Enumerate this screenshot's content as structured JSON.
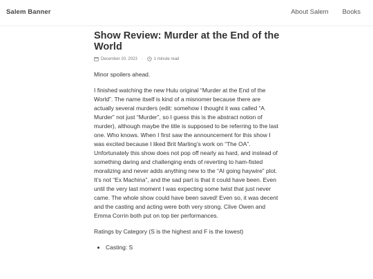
{
  "header": {
    "brand": "Salem Banner",
    "nav": [
      {
        "label": "About Salem"
      },
      {
        "label": "Books"
      }
    ]
  },
  "post": {
    "title": "Show Review: Murder at the End of the World",
    "date": "December 20, 2023",
    "separator": "·",
    "read_time": "1 minute read",
    "icons": [
      "calendar-icon",
      "clock-icon"
    ],
    "paragraphs": {
      "intro": "Minor spoilers ahead.",
      "main": "I finished watching the new Hulu original “Murder at the End of the World”. The name itself is kind of a misnomer because there are actually several murders (edit: somehow I thought it was called “A Murder” not just “Murder”, so I guess this is the abstract notion of murder), although maybe the title is supposed to be referring to the last one. Who knows. When I first saw the announcement for this show I was excited because I liked Brit Marling’s work on “The OA”. Unfortunately this show does not pop off nearly as hard, and instead of something daring and challenging ends of reverting to ham-fisted moralizing and never adds anything new to the “AI going haywire” plot. It’s not “Ex Machina”, and the sad part is that it could have been. Even until the very last moment I was expecting some twist that just never came. The whole show could have been saved! Even so, it was decent and the casting and acting were both very strong. Clive Owen and Emma Corrin both put on top tier performances.",
      "ratings_intro": "Ratings by Category (S is the highest and F is the lowest)"
    },
    "ratings": [
      {
        "label": "Casting: S"
      }
    ]
  }
}
